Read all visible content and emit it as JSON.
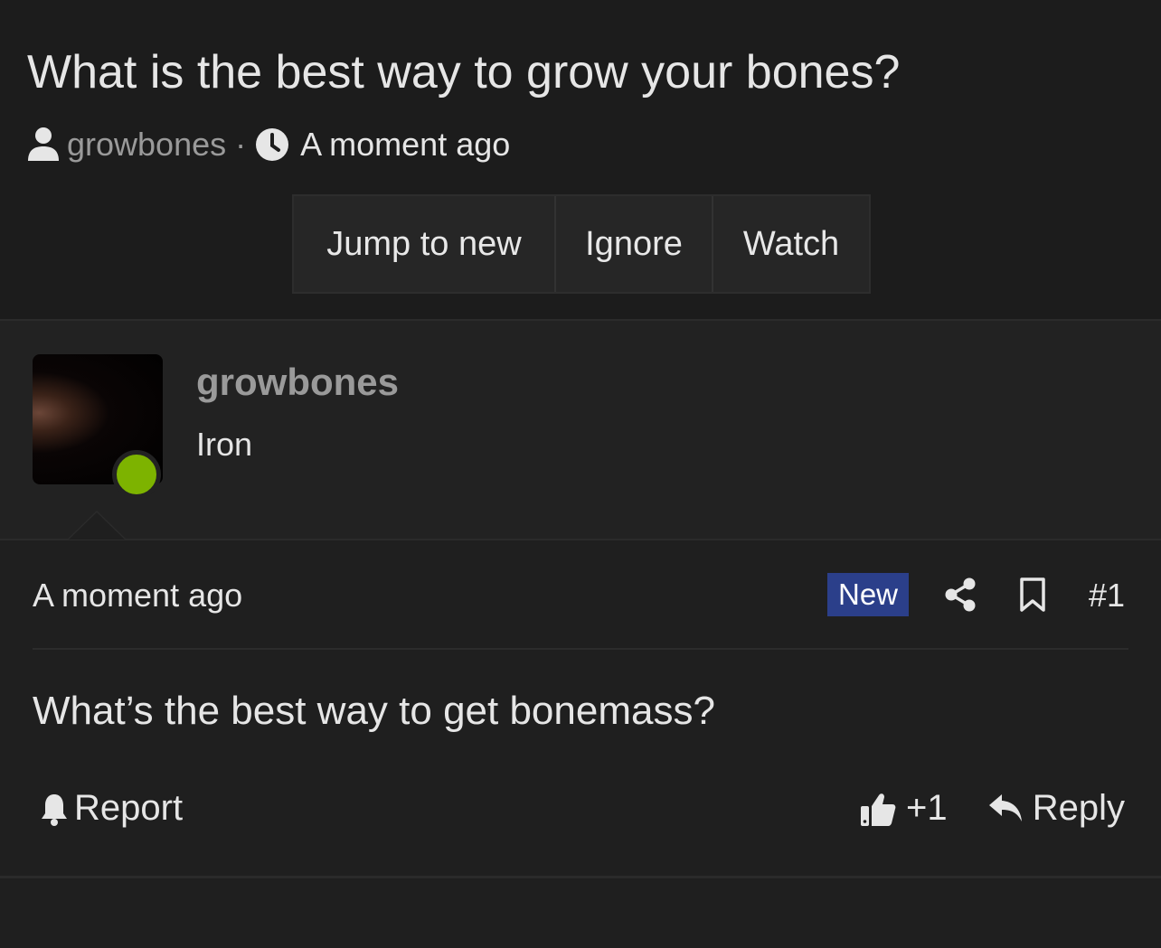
{
  "thread": {
    "title": "What is the best way to grow your bones?",
    "author": "growbones",
    "separator": "·",
    "time": "A moment ago"
  },
  "buttons": {
    "jump_to_new": "Jump to new",
    "ignore": "Ignore",
    "watch": "Watch"
  },
  "user": {
    "name": "growbones",
    "rank": "Iron",
    "status_color": "#7db300"
  },
  "post": {
    "time": "A moment ago",
    "badge": "New",
    "badge_color": "#2b3f8a",
    "number": "#1",
    "body": "What’s the best way to get bonemass?",
    "actions": {
      "report": "Report",
      "like": "+1",
      "reply": "Reply"
    }
  },
  "icons": [
    "user-icon",
    "clock-icon",
    "share-icon",
    "bookmark-icon",
    "bell-icon",
    "thumbs-up-icon",
    "reply-icon"
  ]
}
